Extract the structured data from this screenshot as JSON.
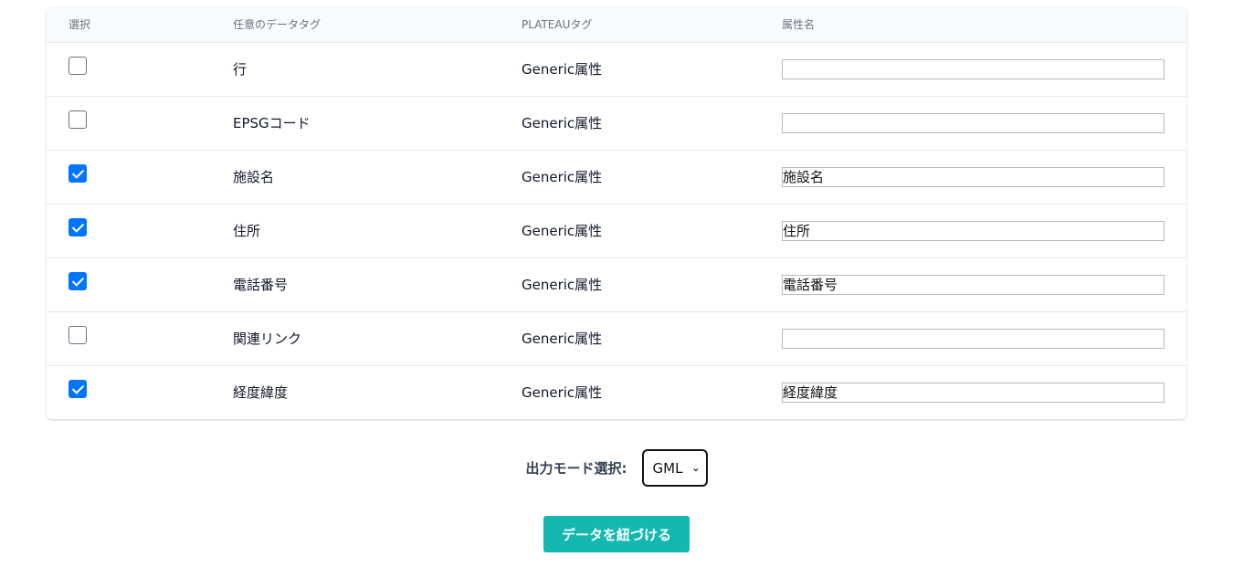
{
  "table": {
    "headers": {
      "select": "選択",
      "data_tag": "任意のデータタグ",
      "plateau_tag": "PLATEAUタグ",
      "attr_name": "属性名"
    },
    "rows": [
      {
        "checked": false,
        "data_tag": "行",
        "plateau_tag": "Generic属性",
        "attr_value": ""
      },
      {
        "checked": false,
        "data_tag": "EPSGコード",
        "plateau_tag": "Generic属性",
        "attr_value": ""
      },
      {
        "checked": true,
        "data_tag": "施設名",
        "plateau_tag": "Generic属性",
        "attr_value": "施設名"
      },
      {
        "checked": true,
        "data_tag": "住所",
        "plateau_tag": "Generic属性",
        "attr_value": "住所"
      },
      {
        "checked": true,
        "data_tag": "電話番号",
        "plateau_tag": "Generic属性",
        "attr_value": "電話番号"
      },
      {
        "checked": false,
        "data_tag": "関連リンク",
        "plateau_tag": "Generic属性",
        "attr_value": ""
      },
      {
        "checked": true,
        "data_tag": "経度緯度",
        "plateau_tag": "Generic属性",
        "attr_value": "経度緯度"
      }
    ]
  },
  "output_mode": {
    "label": "出力モード選択:",
    "selected": "GML"
  },
  "submit": {
    "label": "データを紐づける"
  },
  "colors": {
    "accent": "#14b8b0",
    "checkbox": "#0075ff"
  }
}
